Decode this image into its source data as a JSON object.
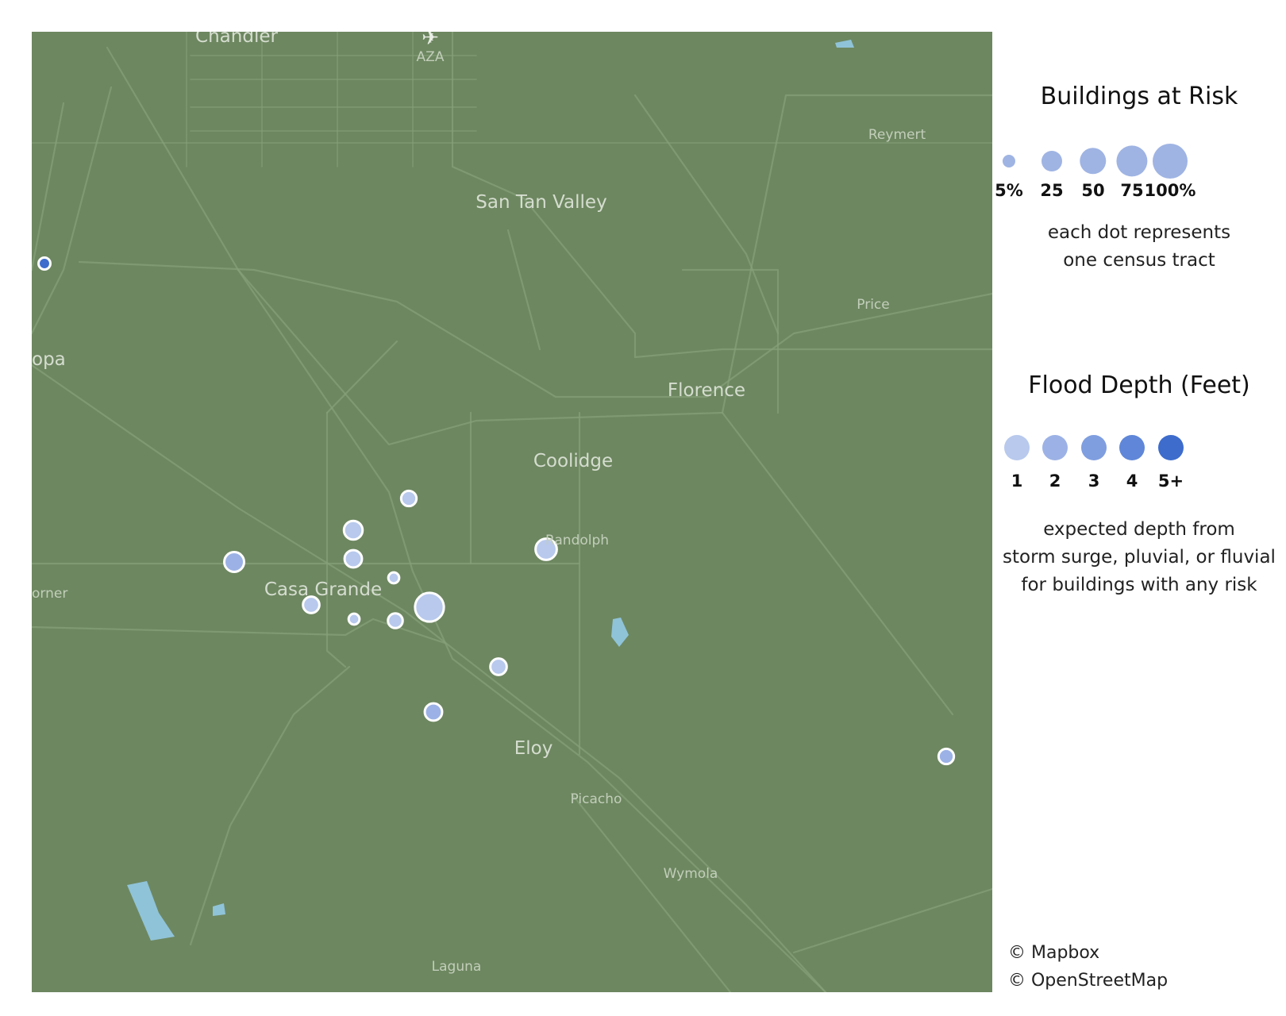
{
  "map": {
    "background_color": "#6d8760",
    "road_color": "#86a07a",
    "water_color": "#8fc3d8",
    "dot_fill_color": "#ffffff",
    "places": [
      {
        "name": "Chandler",
        "size": "big"
      },
      {
        "name": "AZA",
        "size": "small"
      },
      {
        "name": "San Tan Valley",
        "size": "big"
      },
      {
        "name": "Reymert",
        "size": "small"
      },
      {
        "name": "Price",
        "size": "small"
      },
      {
        "name": "opa",
        "size": "big"
      },
      {
        "name": "Florence",
        "size": "big"
      },
      {
        "name": "Coolidge",
        "size": "big"
      },
      {
        "name": "Randolph",
        "size": "small"
      },
      {
        "name": "orner",
        "size": "small"
      },
      {
        "name": "Casa Grande",
        "size": "big"
      },
      {
        "name": "Eloy",
        "size": "big"
      },
      {
        "name": "Picacho",
        "size": "small"
      },
      {
        "name": "Wymola",
        "size": "small"
      },
      {
        "name": "Laguna",
        "size": "small"
      }
    ],
    "airport_icon": "airplane-icon",
    "tracts": [
      {
        "buildings_at_risk_pct": 3,
        "flood_depth": 5
      },
      {
        "buildings_at_risk_pct": 8,
        "flood_depth": 1
      },
      {
        "buildings_at_risk_pct": 15,
        "flood_depth": 1
      },
      {
        "buildings_at_risk_pct": 12,
        "flood_depth": 1
      },
      {
        "buildings_at_risk_pct": 22,
        "flood_depth": 1
      },
      {
        "buildings_at_risk_pct": 18,
        "flood_depth": 2
      },
      {
        "buildings_at_risk_pct": 2,
        "flood_depth": 1
      },
      {
        "buildings_at_risk_pct": 10,
        "flood_depth": 1
      },
      {
        "buildings_at_risk_pct": 2,
        "flood_depth": 1
      },
      {
        "buildings_at_risk_pct": 7,
        "flood_depth": 1
      },
      {
        "buildings_at_risk_pct": 50,
        "flood_depth": 1
      },
      {
        "buildings_at_risk_pct": 10,
        "flood_depth": 1
      },
      {
        "buildings_at_risk_pct": 12,
        "flood_depth": 2
      },
      {
        "buildings_at_risk_pct": 8,
        "flood_depth": 2
      }
    ]
  },
  "legend": {
    "size_title": "Buildings at Risk",
    "size_items": [
      {
        "label": "5%",
        "value": 5
      },
      {
        "label": "25",
        "value": 25
      },
      {
        "label": "50",
        "value": 50
      },
      {
        "label": "75",
        "value": 75
      },
      {
        "label": "100%",
        "value": 100
      }
    ],
    "size_dot_color": "#9fb4e3",
    "size_note_line1": "each dot represents",
    "size_note_line2": "one census tract",
    "depth_title": "Flood Depth (Feet)",
    "depth_items": [
      {
        "label": "1",
        "color": "#b8c9ed"
      },
      {
        "label": "2",
        "color": "#9cb2e6"
      },
      {
        "label": "3",
        "color": "#7f9ee0"
      },
      {
        "label": "4",
        "color": "#5f86d8"
      },
      {
        "label": "5+",
        "color": "#3d6ccc"
      }
    ],
    "depth_note_line1": "expected depth from",
    "depth_note_line2": "storm surge, pluvial, or fluvial",
    "depth_note_line3": "for buildings with any risk"
  },
  "credits": {
    "mapbox": "© Mapbox",
    "osm": "© OpenStreetMap"
  }
}
